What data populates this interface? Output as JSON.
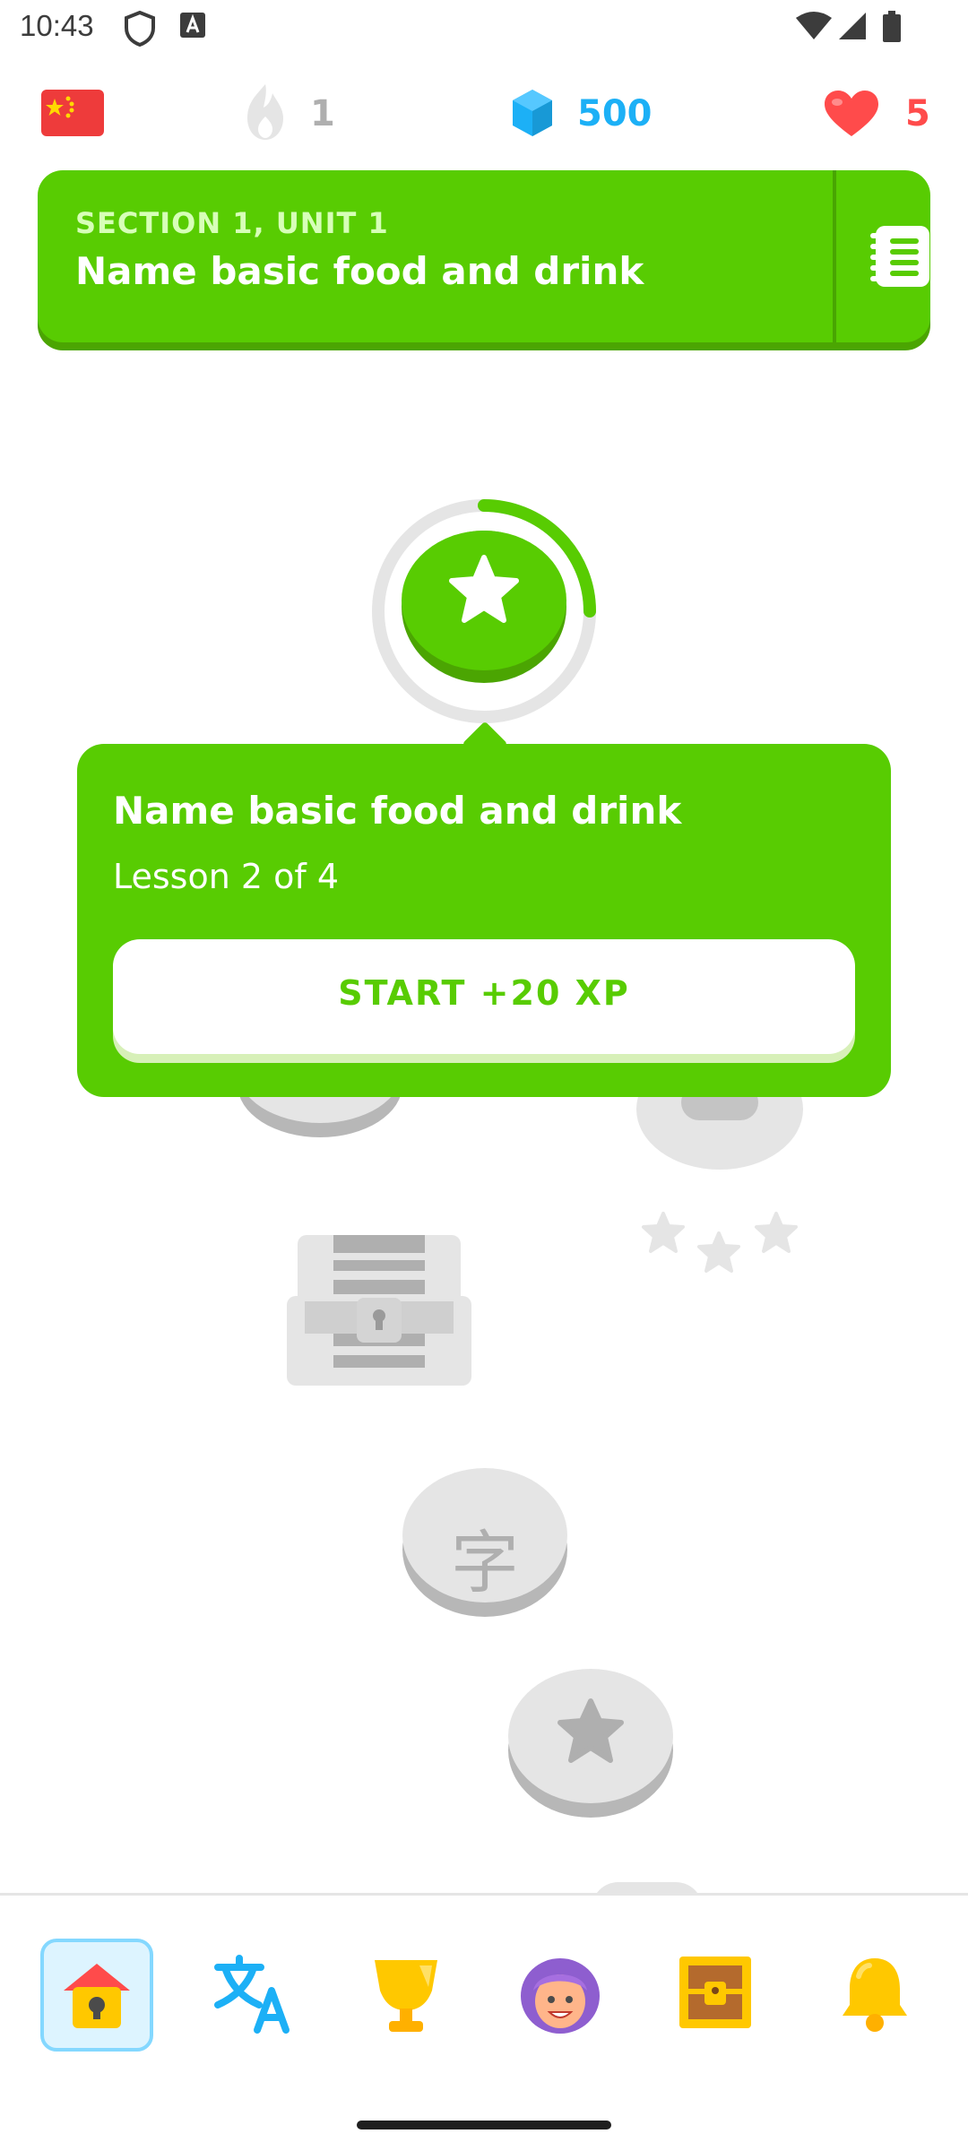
{
  "status_bar": {
    "time": "10:43",
    "icons": [
      "shield-icon",
      "a-icon",
      "wifi-icon",
      "signal-icon",
      "battery-icon"
    ]
  },
  "top_bar": {
    "course_flag": "china-flag-icon",
    "streak_count": "1",
    "gems_count": "500",
    "hearts_count": "5"
  },
  "unit_banner": {
    "kicker": "SECTION 1, UNIT 1",
    "title": "Name basic food and drink",
    "guidebook_icon": "guidebook-icon"
  },
  "current_lesson": {
    "icon": "star-icon",
    "progress_fraction": 0.25
  },
  "popup": {
    "title": "Name basic food and drink",
    "subtitle": "Lesson 2 of 4",
    "start_label": "START +20 XP"
  },
  "path": {
    "character_node_glyph": "字",
    "nodes": [
      "treasure-chest-icon",
      "character-lesson-node",
      "star-lesson-node"
    ]
  },
  "bottom_nav": {
    "items": [
      "home-icon",
      "translate-icon",
      "trophy-icon",
      "profile-avatar-icon",
      "shop-chest-icon",
      "bell-icon"
    ],
    "active": "home"
  },
  "colors": {
    "brand_green": "#58cc02",
    "dark_green": "#4ba502",
    "gem_blue": "#1cb0f6",
    "heart_red": "#ff4b4b",
    "inactive_gray": "#e5e5e5"
  }
}
